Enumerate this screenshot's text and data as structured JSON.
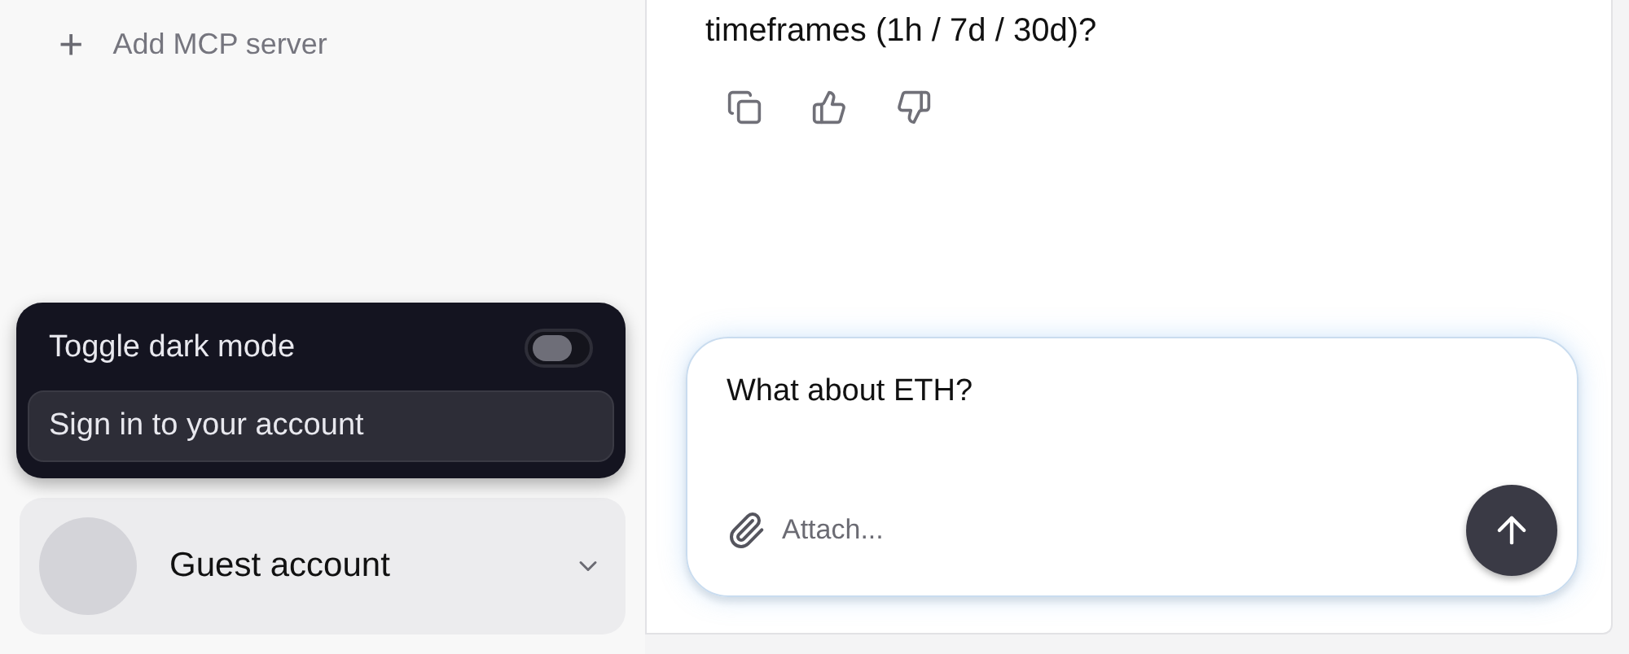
{
  "sidebar": {
    "add_server": {
      "icon": "+",
      "label": "Add MCP server"
    },
    "menu": {
      "items": [
        {
          "kind": "toggle",
          "label": "Toggle dark mode",
          "on": false,
          "selected": false
        },
        {
          "kind": "action",
          "label": "Sign in to your account",
          "selected": true
        }
      ]
    },
    "account": {
      "name": "Guest account"
    }
  },
  "chat": {
    "message_tail": "timeframes (1h / 7d / 30d)?",
    "composer": {
      "value": "What about ETH?",
      "attach_label": "Attach..."
    }
  }
}
